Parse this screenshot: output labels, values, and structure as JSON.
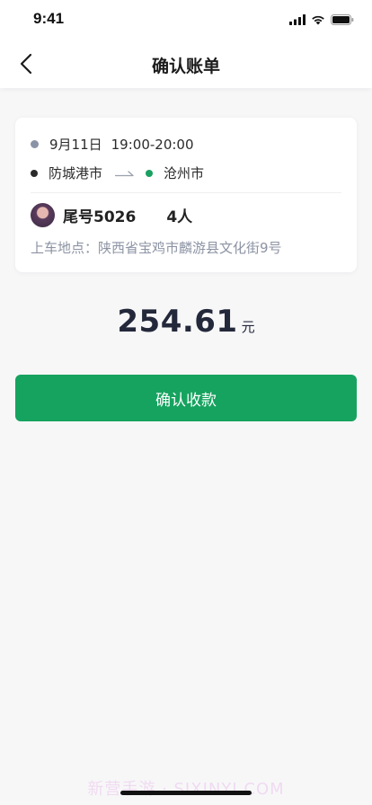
{
  "status_bar": {
    "time": "9:41"
  },
  "nav": {
    "title": "确认账单"
  },
  "trip": {
    "date": "9月11日",
    "time_range": "19:00-20:00",
    "from_city": "防城港市",
    "to_city": "沧州市",
    "passenger_tail": "尾号5026",
    "people": "4人",
    "pickup_label": "上车地点：",
    "pickup_address": "陕西省宝鸡市麟游县文化街9号"
  },
  "price": {
    "amount": "254.61",
    "unit": "元"
  },
  "confirm_button": {
    "label": "确认收款"
  },
  "watermark": "新营手游 · SIXINYI.COM",
  "colors": {
    "accent": "#16a35f",
    "price_text": "#23283a",
    "muted": "#8c93a3"
  }
}
